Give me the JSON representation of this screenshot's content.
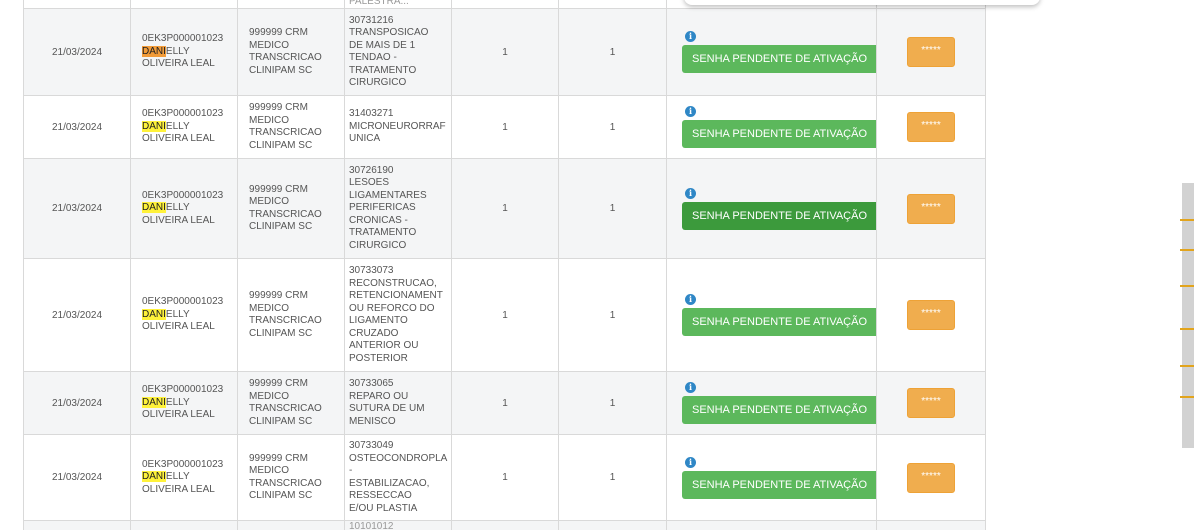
{
  "top_row": {
    "procedure_fragment": "PALESTRA..."
  },
  "rows": [
    {
      "date": "21/03/2024",
      "patient_code": "0EK3P000001023",
      "patient_hl_first": "DANI",
      "patient_name_rest": "ELLY",
      "patient_surname": "OLIVEIRA LEAL",
      "doctor_lines": [
        "999999 CRM",
        "MEDICO",
        "TRANSCRICAO",
        "CLINIPAM SC"
      ],
      "procedure_lines": [
        "30731216",
        "TRANSPOSICAO",
        "DE MAIS DE 1",
        "TENDAO -",
        "TRATAMENTO",
        "CIRURGICO"
      ],
      "qty_requested": "1",
      "qty_authorized": "1",
      "status_label": "SENHA PENDENTE DE ATIVAÇÃO",
      "password_mask": "*****"
    },
    {
      "date": "21/03/2024",
      "patient_code": "0EK3P000001023",
      "patient_hl_first": "DANI",
      "patient_name_rest": "ELLY",
      "patient_surname": "OLIVEIRA LEAL",
      "doctor_lines": [
        "999999 CRM",
        "MEDICO",
        "TRANSCRICAO",
        "CLINIPAM SC"
      ],
      "procedure_lines": [
        "31403271",
        "MICRONEURORRAF",
        "UNICA"
      ],
      "qty_requested": "1",
      "qty_authorized": "1",
      "status_label": "SENHA PENDENTE DE ATIVAÇÃO",
      "password_mask": "*****"
    },
    {
      "date": "21/03/2024",
      "patient_code": "0EK3P000001023",
      "patient_hl_first": "DANI",
      "patient_name_rest": "ELLY",
      "patient_surname": "OLIVEIRA LEAL",
      "doctor_lines": [
        "999999 CRM",
        "MEDICO",
        "TRANSCRICAO",
        "CLINIPAM SC"
      ],
      "procedure_lines": [
        "30726190",
        "LESOES",
        "LIGAMENTARES",
        "PERIFERICAS",
        "CRONICAS -",
        "TRATAMENTO",
        "CIRURGICO"
      ],
      "qty_requested": "1",
      "qty_authorized": "1",
      "status_label": "SENHA PENDENTE DE ATIVAÇÃO",
      "password_mask": "*****"
    },
    {
      "date": "21/03/2024",
      "patient_code": "0EK3P000001023",
      "patient_hl_first": "DANI",
      "patient_name_rest": "ELLY",
      "patient_surname": "OLIVEIRA LEAL",
      "doctor_lines": [
        "999999 CRM",
        "MEDICO",
        "TRANSCRICAO",
        "CLINIPAM SC"
      ],
      "procedure_lines": [
        "30733073",
        "RECONSTRUCAO,",
        "RETENCIONAMENT",
        "OU REFORCO DO",
        "LIGAMENTO",
        "CRUZADO",
        "ANTERIOR OU",
        "POSTERIOR"
      ],
      "qty_requested": "1",
      "qty_authorized": "1",
      "status_label": "SENHA PENDENTE DE ATIVAÇÃO",
      "password_mask": "*****"
    },
    {
      "date": "21/03/2024",
      "patient_code": "0EK3P000001023",
      "patient_hl_first": "DANI",
      "patient_name_rest": "ELLY",
      "patient_surname": "OLIVEIRA LEAL",
      "doctor_lines": [
        "999999 CRM",
        "MEDICO",
        "TRANSCRICAO",
        "CLINIPAM SC"
      ],
      "procedure_lines": [
        "30733065",
        "REPARO OU",
        "SUTURA DE UM",
        "MENISCO"
      ],
      "qty_requested": "1",
      "qty_authorized": "1",
      "status_label": "SENHA PENDENTE DE ATIVAÇÃO",
      "password_mask": "*****"
    },
    {
      "date": "21/03/2024",
      "patient_code": "0EK3P000001023",
      "patient_hl_first": "DANI",
      "patient_name_rest": "ELLY",
      "patient_surname": "OLIVEIRA LEAL",
      "doctor_lines": [
        "999999 CRM",
        "MEDICO",
        "TRANSCRICAO",
        "CLINIPAM SC"
      ],
      "procedure_lines": [
        "30733049",
        "OSTEOCONDROPLA",
        "-",
        "ESTABILIZACAO,",
        "RESSECCAO",
        "E/OU PLASTIA"
      ],
      "qty_requested": "1",
      "qty_authorized": "1",
      "status_label": "SENHA PENDENTE DE ATIVAÇÃO",
      "password_mask": "*****"
    }
  ],
  "bottom_row": {
    "procedure_fragment": "10101012"
  },
  "icons": {
    "info": "info-icon"
  },
  "colors": {
    "status_green": "#5cb85c",
    "status_green_hover": "#3c9a3c",
    "password_orange": "#f0ad4e",
    "highlight_yellow": "#fff23a",
    "highlight_orange": "#f29b38",
    "info_blue": "#2f87c6"
  }
}
